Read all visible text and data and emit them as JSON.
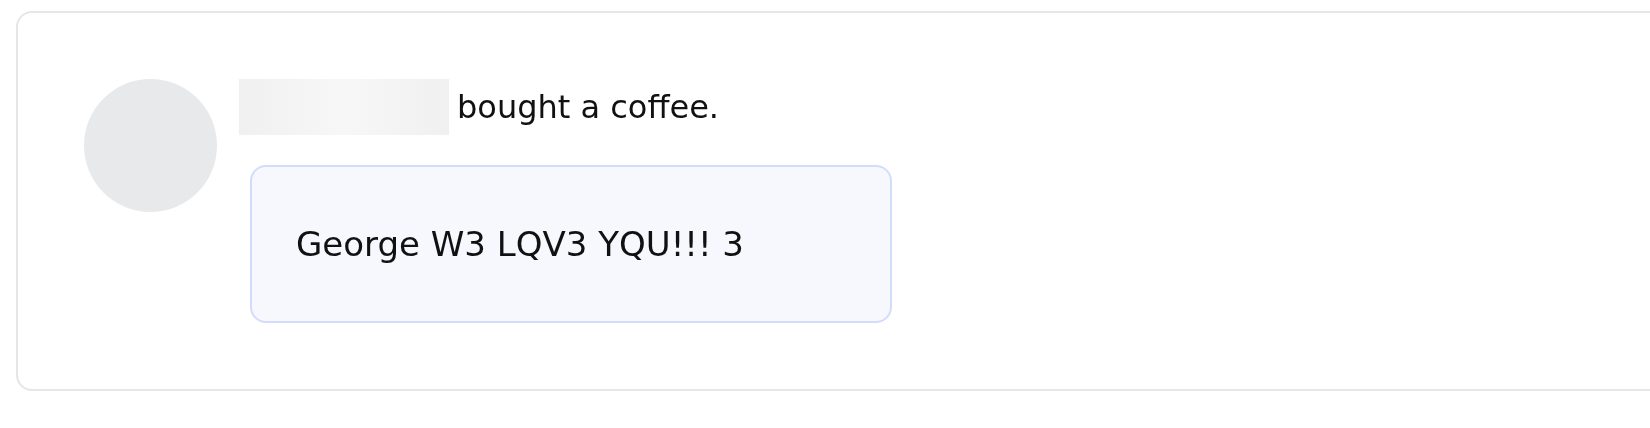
{
  "post": {
    "action": "bought a coffee.",
    "message": "George W3 LQV3 YQU!!! 3"
  }
}
